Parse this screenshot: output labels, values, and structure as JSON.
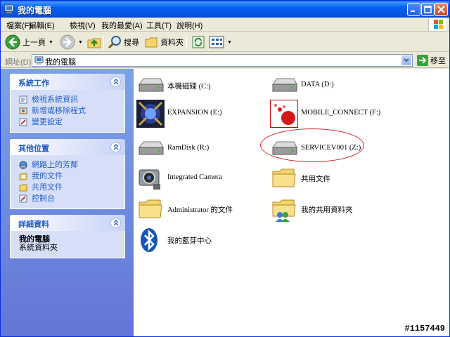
{
  "window": {
    "title": "我的電腦"
  },
  "menu": [
    "檔案(F)",
    "編輯(E)",
    "檢視(V)",
    "我的最愛(A)",
    "工具(T)",
    "說明(H)"
  ],
  "toolbar": {
    "back": "上一頁",
    "search": "搜尋",
    "folders": "資料夾"
  },
  "address": {
    "label": "網址(D)",
    "value": "我的電腦",
    "go": "移至"
  },
  "tasks": {
    "system": {
      "title": "系統工作",
      "links": [
        "檢視系統資訊",
        "新增或移除程式",
        "變更設定"
      ]
    },
    "other": {
      "title": "其他位置",
      "links": [
        "網路上的芳鄰",
        "我的文件",
        "共用文件",
        "控制台"
      ]
    },
    "details": {
      "title": "詳細資料",
      "name": "我的電腦",
      "type": "系統資料夾"
    }
  },
  "items": [
    {
      "name": "本機磁碟 (C:)",
      "icon": "hard-drive-icon"
    },
    {
      "name": "DATA (D:)",
      "icon": "hard-drive-icon"
    },
    {
      "name": "EXPANSION (E:)",
      "icon": "expansion-drive-icon"
    },
    {
      "name": "MOBILE_CONNECT (F:)",
      "icon": "mobile-connect-icon"
    },
    {
      "name": "RamDisk (R:)",
      "icon": "hard-drive-icon"
    },
    {
      "name": "SERVICEV001 (Z:)",
      "icon": "hard-drive-icon"
    },
    {
      "name": "Integrated Camera",
      "icon": "camera-icon"
    },
    {
      "name": "共用文件",
      "icon": "folder-icon"
    },
    {
      "name": "Administrator 的文件",
      "icon": "folder-icon"
    },
    {
      "name": "我的共用資料夾",
      "icon": "shared-folder-icon"
    },
    {
      "name": "我的藍芽中心",
      "icon": "bluetooth-icon"
    }
  ],
  "watermark": "#1157449",
  "colors": {
    "title_bar": "#0453de",
    "task_pane": "#6e8ee0",
    "link": "#215dc6",
    "highlight_ellipse": "#d02020"
  }
}
